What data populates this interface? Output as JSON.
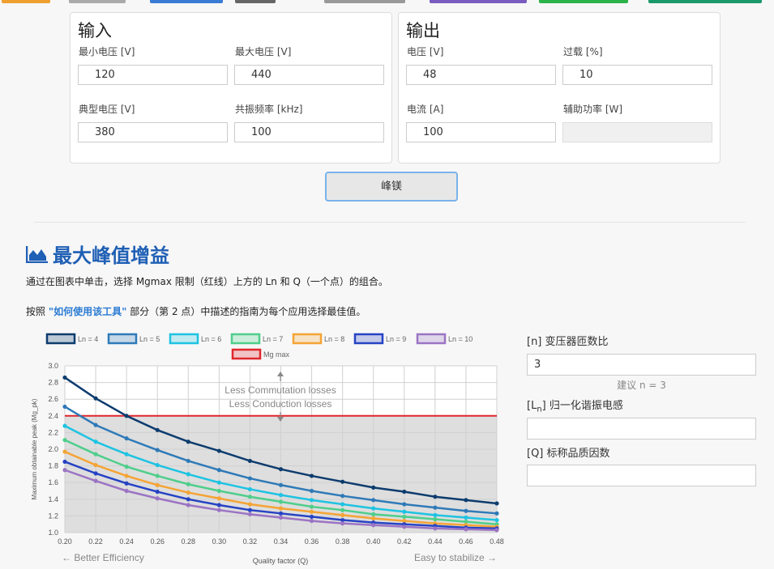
{
  "input_panel": {
    "title": "输入",
    "fields": [
      {
        "label": "最小电压 [V]",
        "value": "120"
      },
      {
        "label": "最大电压 [V]",
        "value": "440"
      },
      {
        "label": "典型电压 [V]",
        "value": "380"
      },
      {
        "label": "共振频率 [kHz]",
        "value": "100"
      }
    ]
  },
  "output_panel": {
    "title": "输出",
    "fields": [
      {
        "label": "电压 [V]",
        "value": "48"
      },
      {
        "label": "过载 [%]",
        "value": "10"
      },
      {
        "label": "电流 [A]",
        "value": "100"
      },
      {
        "label": "辅助功率 [W]",
        "value": ""
      }
    ]
  },
  "calc_button": "峰镁",
  "section": {
    "title": "最大峰值增益",
    "desc1": "通过在图表中单击，选择 Mgmax 限制（红线）上方的 Ln 和 Q（一个点）的组合。",
    "desc2_pre": "按照 ",
    "desc2_link": "\"如何使用该工具\"",
    "desc2_post": " 部分（第 2 点）中描述的指南为每个应用选择最佳值。"
  },
  "params": {
    "n_label": "[n] 变压器匝数比",
    "n_value": "3",
    "n_hint": "建议 n = 3",
    "ln_label_pre": "[L",
    "ln_label_sub": "n",
    "ln_label_post": "] 归一化谐振电感",
    "ln_value": "",
    "q_label": "[Q] 标称品质因数",
    "q_value": ""
  },
  "chart_data": {
    "type": "line",
    "xlabel": "Quality factor (Q)",
    "ylabel": "Maximum obtainable peak (Mg_pk)",
    "xlim": [
      0.2,
      0.48
    ],
    "ylim": [
      1.0,
      3.0
    ],
    "x_ticks": [
      "0.20",
      "0.22",
      "0.24",
      "0.26",
      "0.28",
      "0.30",
      "0.32",
      "0.34",
      "0.36",
      "0.38",
      "0.40",
      "0.42",
      "0.44",
      "0.46",
      "0.48"
    ],
    "y_ticks": [
      "1.0",
      "1.2",
      "1.4",
      "1.6",
      "1.8",
      "2.0",
      "2.2",
      "2.4",
      "2.6",
      "2.8",
      "3.0"
    ],
    "grid": true,
    "legend_position": "top",
    "x": [
      0.2,
      0.22,
      0.24,
      0.26,
      0.28,
      0.3,
      0.32,
      0.34,
      0.36,
      0.38,
      0.4,
      0.42,
      0.44,
      0.46,
      0.48
    ],
    "series": [
      {
        "name": "Ln = 4",
        "color": "#0d3c6e",
        "values": [
          2.86,
          2.61,
          2.4,
          2.23,
          2.09,
          1.98,
          1.86,
          1.76,
          1.68,
          1.61,
          1.54,
          1.49,
          1.43,
          1.39,
          1.35
        ]
      },
      {
        "name": "Ln = 5",
        "color": "#2f7ab8",
        "values": [
          2.51,
          2.29,
          2.13,
          1.99,
          1.86,
          1.75,
          1.65,
          1.57,
          1.5,
          1.44,
          1.39,
          1.34,
          1.3,
          1.26,
          1.23
        ]
      },
      {
        "name": "Ln = 6",
        "color": "#1ec3e2",
        "values": [
          2.28,
          2.09,
          1.94,
          1.81,
          1.7,
          1.6,
          1.52,
          1.45,
          1.39,
          1.34,
          1.29,
          1.25,
          1.21,
          1.18,
          1.15
        ]
      },
      {
        "name": "Ln = 7",
        "color": "#4fce8b",
        "values": [
          2.11,
          1.94,
          1.79,
          1.68,
          1.58,
          1.5,
          1.43,
          1.37,
          1.31,
          1.27,
          1.22,
          1.19,
          1.16,
          1.13,
          1.1
        ]
      },
      {
        "name": "Ln = 8",
        "color": "#f5a435",
        "values": [
          1.97,
          1.81,
          1.68,
          1.57,
          1.48,
          1.41,
          1.34,
          1.29,
          1.25,
          1.21,
          1.17,
          1.14,
          1.11,
          1.09,
          1.07
        ]
      },
      {
        "name": "Ln = 9",
        "color": "#2643c4",
        "values": [
          1.85,
          1.71,
          1.59,
          1.49,
          1.4,
          1.33,
          1.27,
          1.23,
          1.19,
          1.15,
          1.12,
          1.1,
          1.08,
          1.06,
          1.05
        ]
      },
      {
        "name": "Ln = 10",
        "color": "#9b74c4",
        "values": [
          1.75,
          1.62,
          1.5,
          1.41,
          1.33,
          1.27,
          1.22,
          1.18,
          1.14,
          1.11,
          1.09,
          1.07,
          1.05,
          1.04,
          1.03
        ]
      }
    ],
    "mg_max": {
      "name": "Mg max",
      "color": "#e0262b",
      "value": 2.4
    },
    "annotations": {
      "up_line1": "Less Commutation losses",
      "up_line2": "Less Conduction losses",
      "left_bottom": "← Better Efficiency",
      "right_bottom": "Easy to stabilize →"
    }
  }
}
